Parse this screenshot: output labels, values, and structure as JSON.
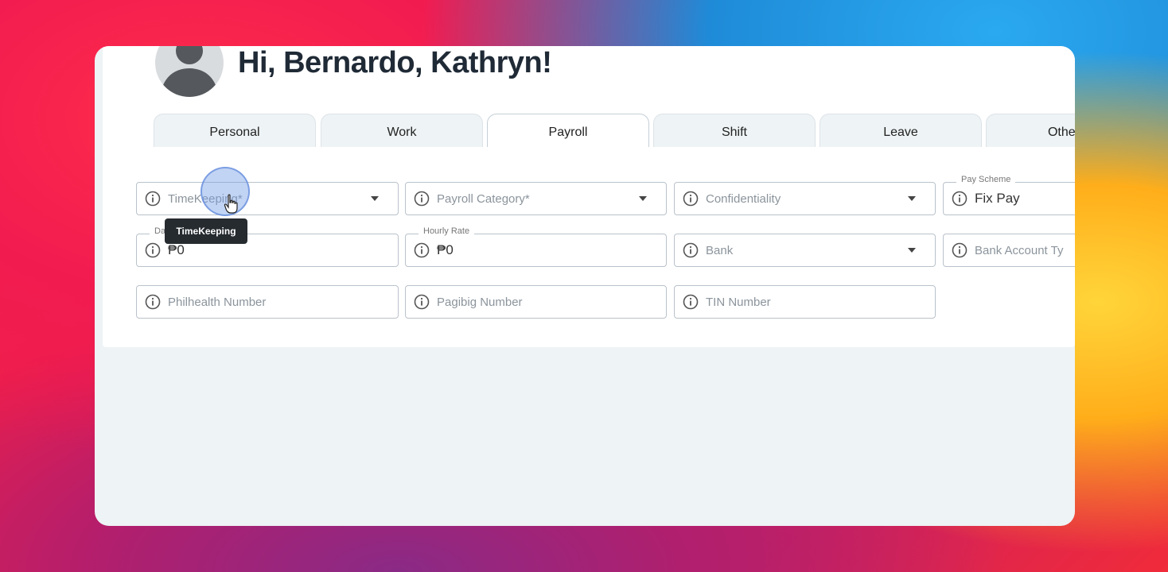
{
  "user": {
    "greeting": "Hi, Bernardo, Kathryn!"
  },
  "tabs": [
    {
      "label": "Personal",
      "active": false
    },
    {
      "label": "Work",
      "active": false
    },
    {
      "label": "Payroll",
      "active": true
    },
    {
      "label": "Shift",
      "active": false
    },
    {
      "label": "Leave",
      "active": false
    },
    {
      "label": "Others",
      "active": false
    }
  ],
  "fields": {
    "timekeeping": {
      "placeholder": "TimeKeeping*"
    },
    "payroll_category": {
      "placeholder": "Payroll Category*"
    },
    "confidentiality": {
      "placeholder": "Confidentiality"
    },
    "pay_scheme": {
      "label": "Pay Scheme",
      "value": "Fix Pay"
    },
    "daily_rate": {
      "label": "Da",
      "value": "₱0"
    },
    "hourly_rate": {
      "label": "Hourly Rate",
      "value": "₱0"
    },
    "bank": {
      "placeholder": "Bank"
    },
    "bank_account_type": {
      "placeholder": "Bank Account Ty"
    },
    "philhealth": {
      "placeholder": "Philhealth Number"
    },
    "pagibig": {
      "placeholder": "Pagibig Number"
    },
    "tin": {
      "placeholder": "TIN Number"
    }
  },
  "tooltip": {
    "text": "TimeKeeping"
  },
  "icons": {
    "field_info": "info-icon",
    "dropdown": "chevron-down-icon",
    "cursor": "hand-pointer-icon"
  },
  "colors": {
    "text": "#1f2a36",
    "border": "#b9c2ca",
    "tooltip_bg": "#262b30",
    "window_bg": "#eef3f5"
  }
}
